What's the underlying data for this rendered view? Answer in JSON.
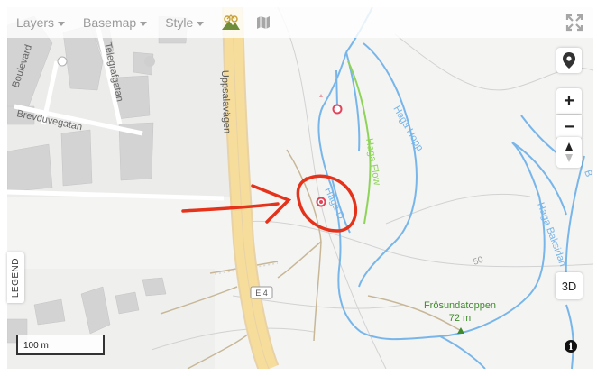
{
  "toolbar": {
    "layers_label": "Layers",
    "basemap_label": "Basemap",
    "style_label": "Style"
  },
  "map": {
    "streets": [
      "Boulevard",
      "Telegrafgatan",
      "Brevduvegatan",
      "Uppsalavägen"
    ],
    "road_shield": "E 4",
    "trails": [
      "Haga Hopp",
      "Haga Flow",
      "Haga D",
      "Haga Baksidan"
    ],
    "contour_label": "50",
    "peak_name": "Frösundatoppen",
    "peak_elevation": "72 m",
    "partial_label_right": "B",
    "colors": {
      "trail": "#74b3e8",
      "flow_trail": "#8fd45a",
      "highway": "#f2cf8a",
      "annotation": "#e5321a",
      "poi": "#e0455a",
      "peak_text": "#3f8a2c"
    }
  },
  "controls": {
    "locate_icon": "map-pin-icon",
    "zoom_in": "+",
    "zoom_out": "−",
    "three_d": "3D",
    "info": "i"
  },
  "legend_label": "LEGEND",
  "scale_label": "100 m"
}
